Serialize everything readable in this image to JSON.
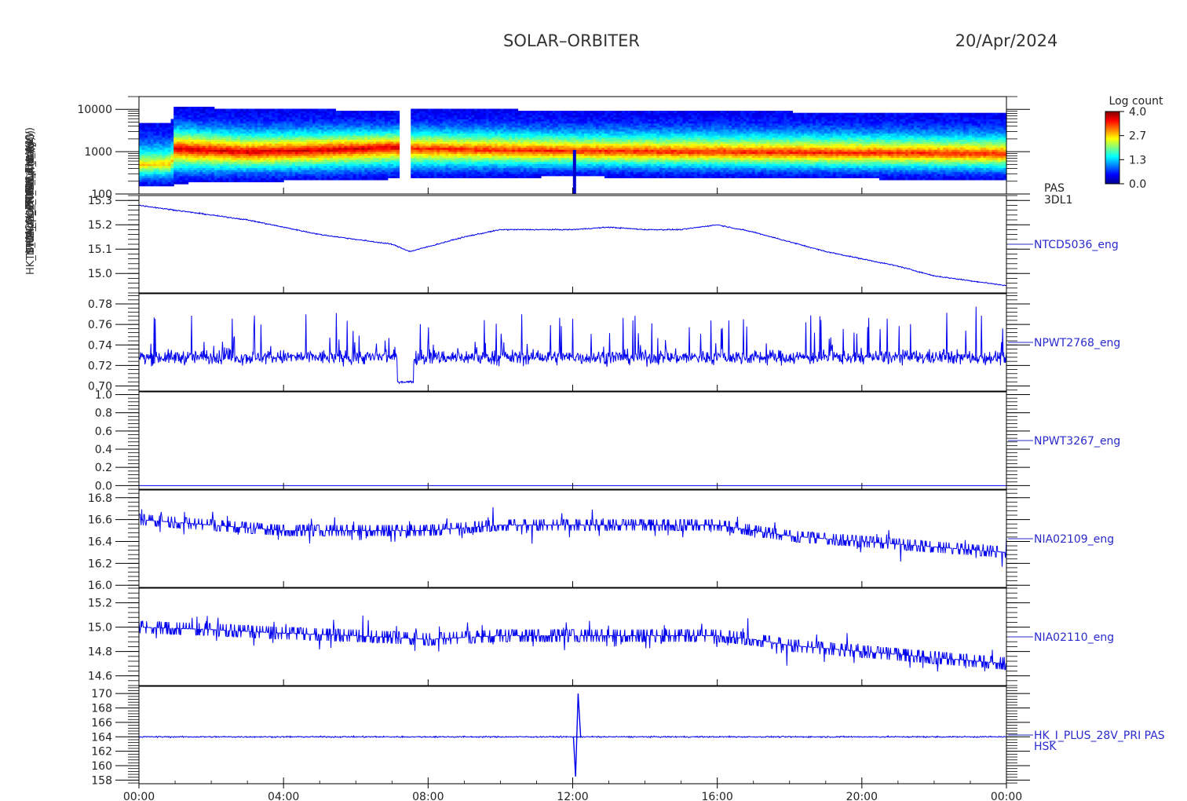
{
  "header": {
    "mission": "SOLAR–ORBITER",
    "date": "20/Apr/2024"
  },
  "colorbar": {
    "title": "Log count",
    "ticks": [
      "4.0",
      "2.7",
      "1.3",
      "0.0"
    ],
    "range": [
      0.0,
      4.0
    ]
  },
  "y_labels_stacked": [
    "(eV)",
    "Approx Temp (DegC)",
    "FOBW Plan (V)",
    "TSWA_ALM_IVSWA_1 (V)",
    "L_HIGH_CH_A4",
    "THERM_CH_MCA (nA)",
    "L_IMON_PRIM_L (mA)",
    "HK_IMON_FOPRIME (mA)"
  ],
  "colors": {
    "trace": "#0000ee",
    "label": "#2a2acc",
    "axis": "#000000"
  },
  "x_axis": {
    "ticks": [
      "00:00",
      "04:00",
      "08:00",
      "12:00",
      "16:00",
      "20:00",
      "00:00"
    ],
    "range_hours": [
      0,
      24
    ]
  },
  "chart_data": [
    {
      "type": "heatmap",
      "id": "pas",
      "right_labels": [
        "PAS",
        "3DL1"
      ],
      "yscale": "log",
      "ylim": [
        100,
        20000
      ],
      "yticks": [
        100,
        1000,
        10000
      ],
      "ytick_labels": [
        "100",
        "1000",
        "10000"
      ],
      "data_gaps_hours": [
        [
          7.2,
          7.5
        ]
      ],
      "data_start_hour": 0.0,
      "data_end_hour": 24.0,
      "energy_envelope": [
        {
          "x": 0.0,
          "low": 150,
          "peak": 500,
          "high": 5000
        },
        {
          "x": 0.9,
          "low": 150,
          "peak": 520,
          "high": 5000
        },
        {
          "x": 1.0,
          "low": 180,
          "peak": 1200,
          "high": 12000
        },
        {
          "x": 3.0,
          "low": 200,
          "peak": 1000,
          "high": 10000
        },
        {
          "x": 5.0,
          "low": 210,
          "peak": 1100,
          "high": 10000
        },
        {
          "x": 7.0,
          "low": 230,
          "peak": 1300,
          "high": 9000
        },
        {
          "x": 7.6,
          "low": 230,
          "peak": 1200,
          "high": 10000
        },
        {
          "x": 10.0,
          "low": 250,
          "peak": 1100,
          "high": 10000
        },
        {
          "x": 12.0,
          "low": 260,
          "peak": 1050,
          "high": 9000
        },
        {
          "x": 16.0,
          "low": 240,
          "peak": 1000,
          "high": 9000
        },
        {
          "x": 20.0,
          "low": 230,
          "peak": 950,
          "high": 8500
        },
        {
          "x": 24.0,
          "low": 220,
          "peak": 900,
          "high": 8000
        }
      ]
    },
    {
      "type": "line",
      "id": "ntcd5036",
      "right_label": "NTCD5036_eng",
      "ylim": [
        14.92,
        15.32
      ],
      "yticks": [
        15.0,
        15.1,
        15.2,
        15.3
      ],
      "ytick_labels": [
        "15.0",
        "15.1",
        "15.2",
        "15.3"
      ],
      "x": [
        0,
        1,
        2,
        3,
        4,
        5,
        6,
        7,
        7.5,
        8,
        9,
        10,
        11,
        12,
        13,
        14,
        15,
        16,
        17,
        18,
        19,
        20,
        21,
        22,
        23,
        24
      ],
      "y": [
        15.28,
        15.26,
        15.24,
        15.22,
        15.19,
        15.16,
        15.14,
        15.12,
        15.09,
        15.11,
        15.15,
        15.18,
        15.18,
        15.18,
        15.19,
        15.18,
        15.18,
        15.2,
        15.17,
        15.13,
        15.09,
        15.06,
        15.03,
        14.99,
        14.97,
        14.95
      ],
      "noise": 0.004
    },
    {
      "type": "line",
      "id": "npwt2768",
      "right_label": "NPWT2768_eng",
      "ylim": [
        0.695,
        0.79
      ],
      "yticks": [
        0.7,
        0.72,
        0.74,
        0.76,
        0.78
      ],
      "ytick_labels": [
        "0.70",
        "0.72",
        "0.74",
        "0.76",
        "0.78"
      ],
      "baseline": 0.728,
      "spread": 0.012,
      "dip": {
        "x0": 7.15,
        "x1": 7.6,
        "y": 0.704
      }
    },
    {
      "type": "line",
      "id": "npwt3267",
      "right_label": "NPWT3267_eng",
      "ylim": [
        -0.04,
        1.03
      ],
      "yticks": [
        0.0,
        0.2,
        0.4,
        0.6,
        0.8,
        1.0
      ],
      "ytick_labels": [
        "0.0",
        "0.2",
        "0.4",
        "0.6",
        "0.8",
        "1.0"
      ],
      "baseline": 0.0
    },
    {
      "type": "line",
      "id": "nia02109",
      "right_label": "NIA02109_eng",
      "ylim": [
        15.98,
        16.87
      ],
      "yticks": [
        16.0,
        16.2,
        16.4,
        16.6,
        16.8
      ],
      "ytick_labels": [
        "16.0",
        "16.2",
        "16.4",
        "16.6",
        "16.8"
      ],
      "x": [
        0,
        2,
        4,
        6,
        8,
        10,
        12,
        14,
        16,
        17,
        18,
        20,
        22,
        24
      ],
      "y": [
        16.6,
        16.55,
        16.5,
        16.5,
        16.5,
        16.55,
        16.55,
        16.55,
        16.55,
        16.5,
        16.45,
        16.4,
        16.35,
        16.3
      ],
      "spread": 0.1
    },
    {
      "type": "line",
      "id": "nia02110",
      "right_label": "NIA02110_eng",
      "ylim": [
        14.52,
        15.32
      ],
      "yticks": [
        14.6,
        14.8,
        15.0,
        15.2
      ],
      "ytick_labels": [
        "14.6",
        "14.8",
        "15.0",
        "15.2"
      ],
      "x": [
        0,
        2,
        4,
        6,
        8,
        10,
        12,
        14,
        16,
        17,
        18,
        20,
        22,
        24
      ],
      "y": [
        15.0,
        14.98,
        14.95,
        14.93,
        14.9,
        14.93,
        14.93,
        14.93,
        14.93,
        14.9,
        14.85,
        14.8,
        14.75,
        14.7
      ],
      "spread": 0.1
    },
    {
      "type": "line",
      "id": "hk_i_plus_28v",
      "right_labels": [
        "HK_I_PLUS_28V_PRI PAS",
        "HSK"
      ],
      "ylim": [
        157.5,
        171
      ],
      "yticks": [
        158,
        160,
        162,
        164,
        166,
        168,
        170
      ],
      "ytick_labels": [
        "158",
        "160",
        "162",
        "164",
        "166",
        "168",
        "170"
      ],
      "baseline": 164.0,
      "spread": 0.4,
      "spike": {
        "x": 12.1,
        "min": 158.5,
        "max": 170.0
      }
    }
  ]
}
